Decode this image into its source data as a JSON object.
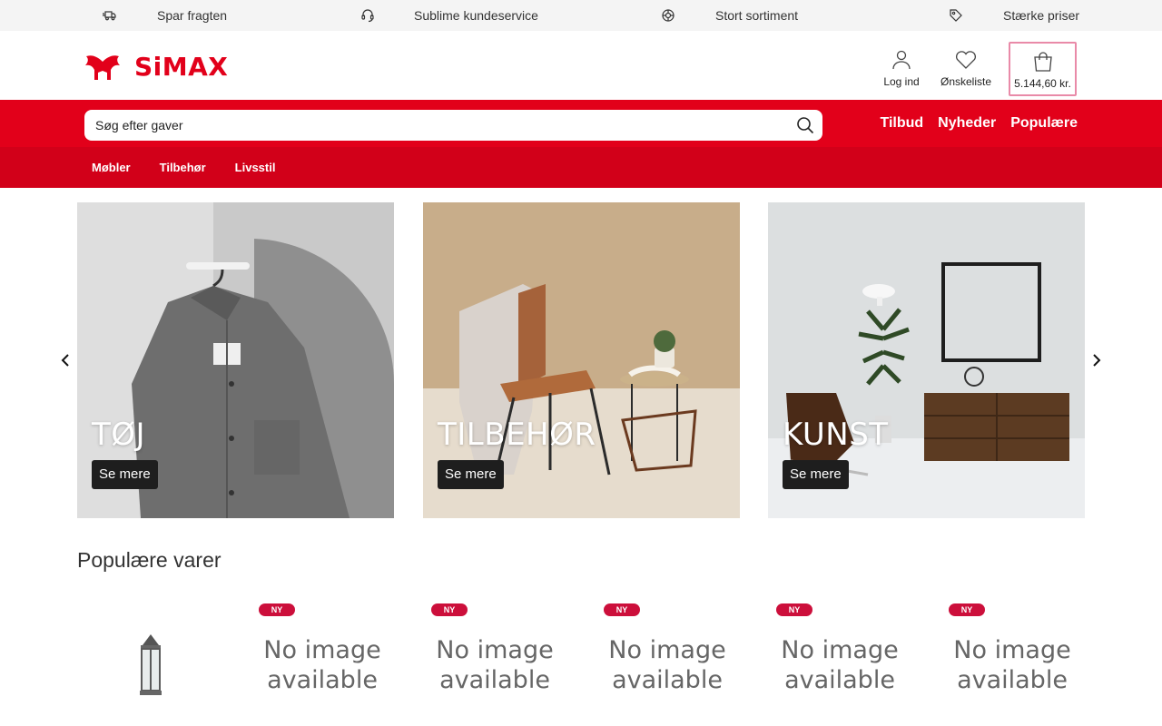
{
  "usp_bar": {
    "items": [
      {
        "icon": "delivery-truck-icon",
        "label": "Spar fragten"
      },
      {
        "icon": "headset-icon",
        "label": "Sublime kundeservice"
      },
      {
        "icon": "assortment-icon",
        "label": "Stort sortiment"
      },
      {
        "icon": "price-tag-icon",
        "label": "Stærke priser"
      }
    ]
  },
  "header": {
    "brand": "SiMAX",
    "brand_color": "#e2001a",
    "login_label": "Log ind",
    "wishlist_label": "Ønskeliste",
    "cart_total": "5.144,60 kr."
  },
  "search": {
    "placeholder": "Søg efter gaver",
    "quick_links": [
      "Tilbud",
      "Nyheder",
      "Populære"
    ]
  },
  "category_nav": [
    "Møbler",
    "Tilbehør",
    "Livsstil"
  ],
  "carousel": {
    "tiles": [
      {
        "title": "TØJ",
        "button": "Se mere"
      },
      {
        "title": "TILBEHØR",
        "button": "Se mere"
      },
      {
        "title": "KUNST",
        "button": "Se mere"
      }
    ]
  },
  "popular": {
    "title": "Populære varer",
    "badge": "NY",
    "no_image_line1": "No image",
    "no_image_line2": "available"
  }
}
